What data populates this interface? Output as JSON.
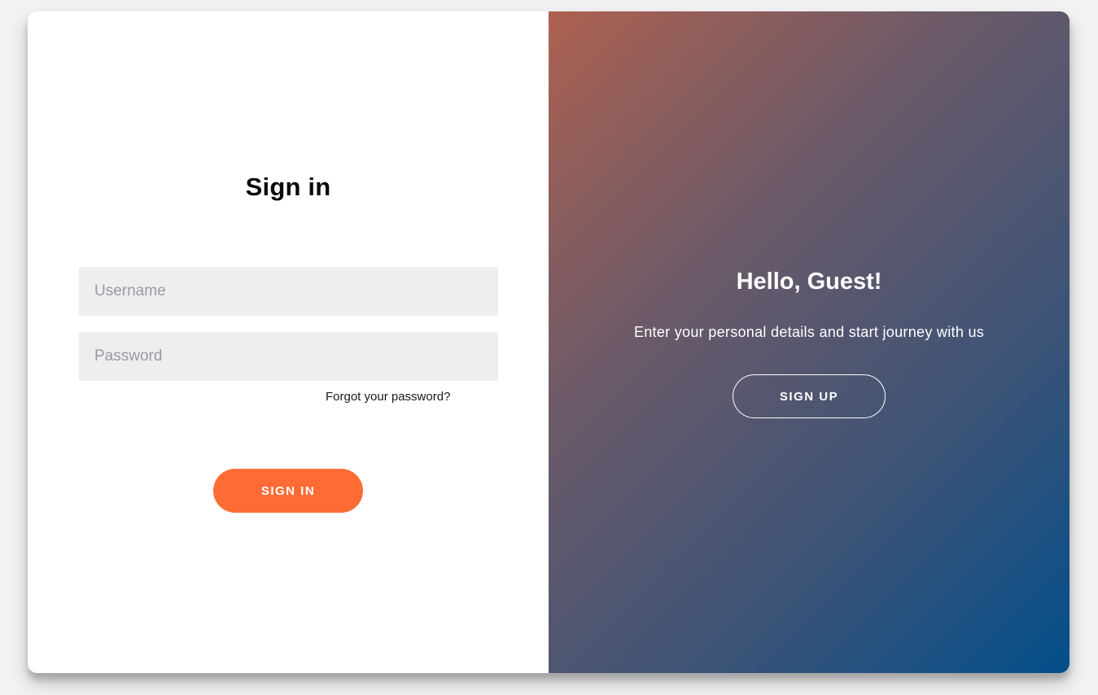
{
  "signin_panel": {
    "title": "Sign in",
    "username_placeholder": "Username",
    "password_placeholder": "Password",
    "forgot_link": "Forgot your password?",
    "signin_button": "SIGN IN"
  },
  "guest_panel": {
    "title": "Hello, Guest!",
    "subtitle": "Enter your personal details and start journey with us",
    "signup_button": "SIGN UP"
  },
  "colors": {
    "accent": "#ff6b35",
    "input_bg": "#eeeeee",
    "gradient_start": "#ad6150",
    "gradient_end": "#024f8b"
  }
}
